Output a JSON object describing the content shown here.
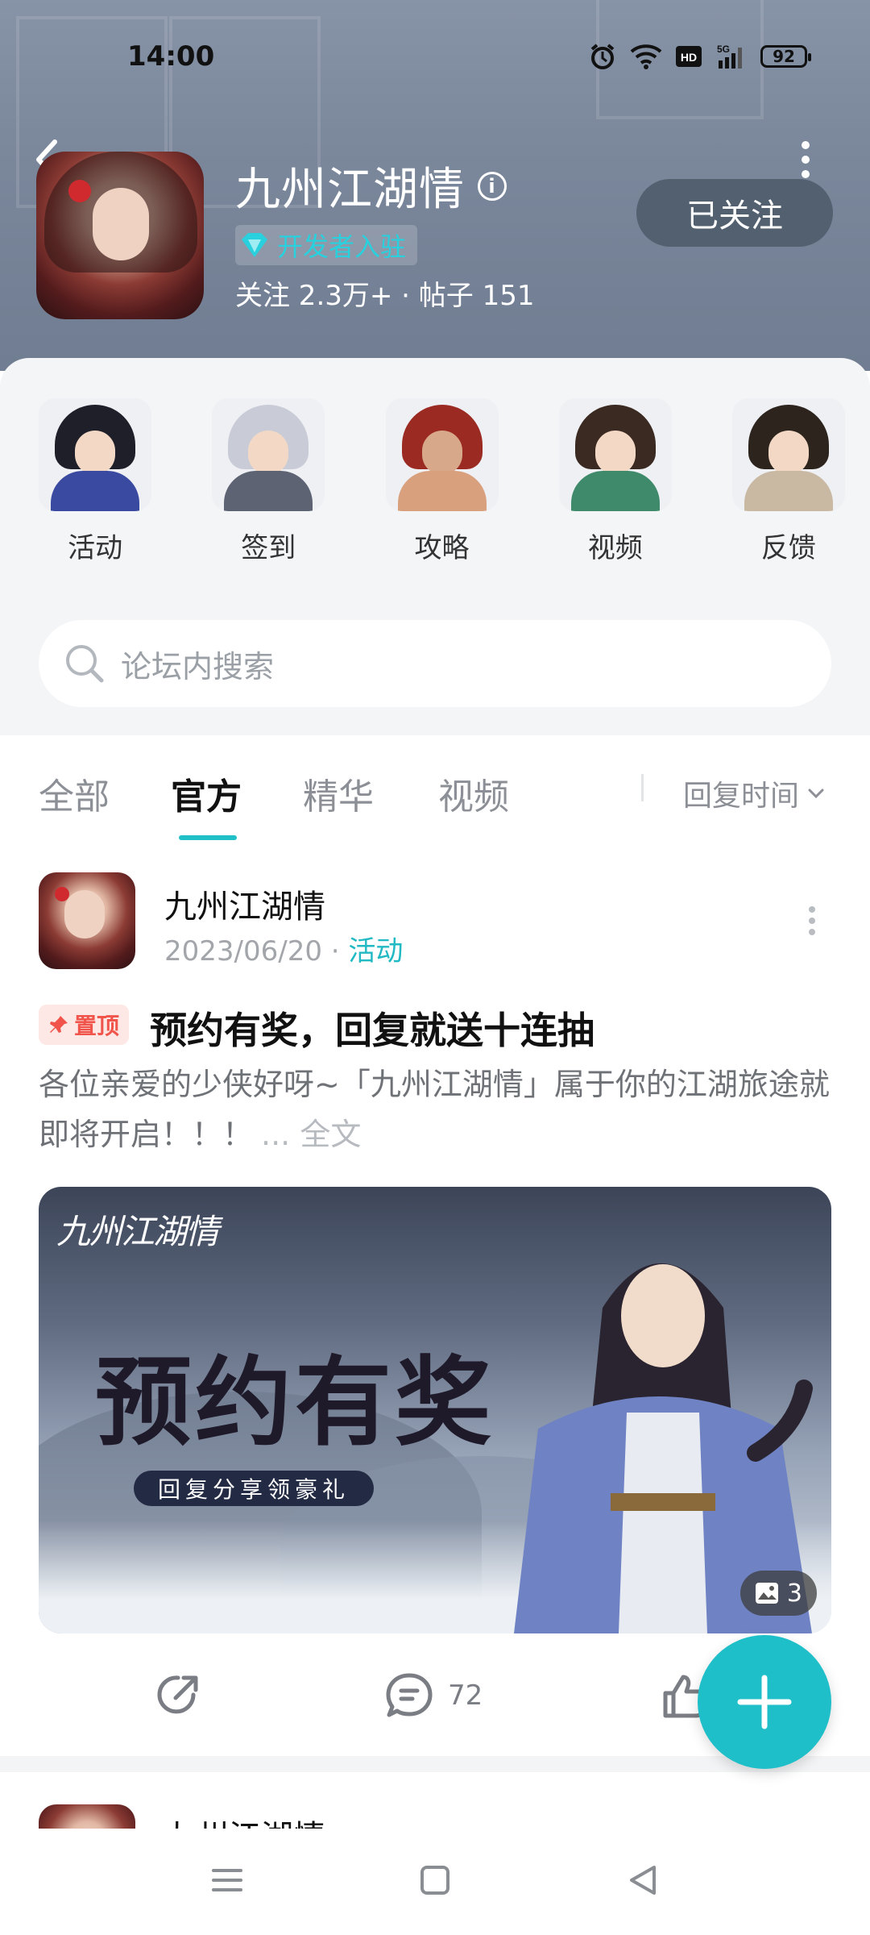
{
  "status_bar": {
    "time": "14:00",
    "battery": "92"
  },
  "header": {
    "title": "九州江湖情",
    "developer_badge": "开发者入驻",
    "stats": "关注 2.3万+ · 帖子 151",
    "follow_button": "已关注"
  },
  "shortcuts": [
    {
      "label": "活动"
    },
    {
      "label": "签到"
    },
    {
      "label": "攻略"
    },
    {
      "label": "视频"
    },
    {
      "label": "反馈"
    }
  ],
  "search": {
    "placeholder": "论坛内搜索"
  },
  "tabs": [
    {
      "label": "全部"
    },
    {
      "label": "官方",
      "active": true
    },
    {
      "label": "精华"
    },
    {
      "label": "视频"
    }
  ],
  "sort": {
    "label": "回复时间"
  },
  "post": {
    "author": "九州江湖情",
    "date": "2023/06/20",
    "dot": "·",
    "category": "活动",
    "pin_label": "置顶",
    "title": "预约有奖，回复就送十连抽",
    "body": "各位亲爱的少侠好呀~「九州江湖情」属于你的江湖旅途就即将开启！！！",
    "more": "... 全文",
    "image": {
      "logo_text": "九州江湖情",
      "headline": "预约有奖",
      "ribbon": "回复分享领豪礼",
      "count": "3"
    },
    "comments": "72"
  },
  "next_post": {
    "author": "九州江湖情"
  }
}
